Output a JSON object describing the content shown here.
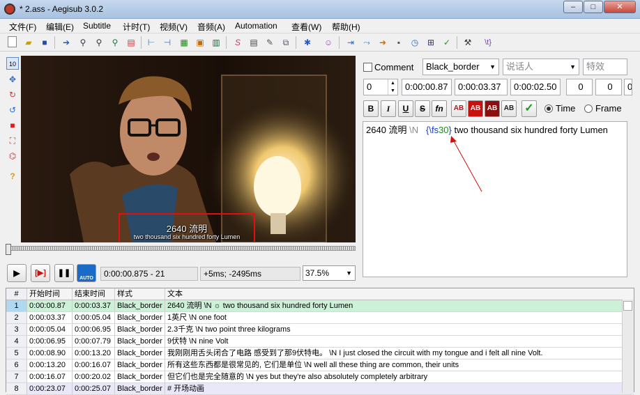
{
  "window": {
    "title": "* 2.ass - Aegisub 3.0.2",
    "minimize": "–",
    "maximize": "□",
    "close": "✕"
  },
  "menu": [
    "文件(F)",
    "编辑(E)",
    "Subtitle",
    "计时(T)",
    "视频(V)",
    "音频(A)",
    "Automation",
    "查看(W)",
    "帮助(H)"
  ],
  "toolbar": {
    "items": [
      "new-icon",
      "open-icon",
      "save-icon",
      "jump-icon",
      "zoom-icon",
      "search-icon",
      "replace-icon",
      "properties-icon",
      "fonts-icon",
      "snap-start-icon",
      "snap-end-icon",
      "keyframe-icon",
      "video-details-icon",
      "shift-times-icon",
      "style-manager-icon",
      "attachments-icon",
      "timing-post-icon",
      "translation-icon",
      "resample-icon",
      "automation-icon",
      "options-icon",
      "scale-icon",
      "tags-toggle-icon",
      "kanji-timer-icon",
      "spell-check-icon",
      "hide-tags-icon"
    ],
    "tags_label": "\\t}"
  },
  "video_tools": [
    "standard-tool",
    "drag-tool",
    "rotate-z-tool",
    "rotate-xy-tool",
    "scale-tool",
    "clip-tool",
    "vector-clip-tool",
    "help-tool"
  ],
  "video": {
    "subtitle_line1": "2640 流明",
    "subtitle_line2": "two thousand six hundred forty Lumen"
  },
  "playback": {
    "play": "▶",
    "play_line": "[▶]",
    "pause": "❚❚",
    "auto_label": "AUTO",
    "time_frame": "0:00:00.875 - 21",
    "offset": "+5ms; -2495ms",
    "zoom": "37.5%"
  },
  "edit": {
    "comment_label": "Comment",
    "style": "Black_border",
    "actor_placeholder": "说话人",
    "effect_placeholder": "特效",
    "layer": "0",
    "start": "0:00:00.87",
    "end": "0:00:03.37",
    "duration": "0:00:02.50",
    "margin_l": "0",
    "margin_r": "0",
    "margin_v": "0",
    "bold": "B",
    "italic": "I",
    "underline": "U",
    "strike": "S",
    "font": "fn",
    "color_labels": [
      "AB",
      "AB",
      "AB",
      "AB"
    ],
    "commit": "✓",
    "time_label": "Time",
    "frame_label": "Frame",
    "text_prefix": "2640 流明 ",
    "text_newline": "\\N",
    "text_tag_open": "{\\fs",
    "text_tag_val": "30",
    "text_tag_close": "}",
    "text_rest": " two thousand six hundred forty Lumen"
  },
  "grid": {
    "headers": [
      "#",
      "开始时间",
      "结束时间",
      "样式",
      "文本"
    ],
    "rows": [
      [
        "1",
        "0:00:00.87",
        "0:00:03.37",
        "Black_border",
        "2640 流明 \\N ☼ two thousand six hundred forty Lumen"
      ],
      [
        "2",
        "0:00:03.37",
        "0:00:05.04",
        "Black_border",
        "1英尺 \\N one foot"
      ],
      [
        "3",
        "0:00:05.04",
        "0:00:06.95",
        "Black_border",
        "2.3千克 \\N two point three kilograms"
      ],
      [
        "4",
        "0:00:06.95",
        "0:00:07.79",
        "Black_border",
        "9伏特 \\N nine Volt"
      ],
      [
        "5",
        "0:00:08.90",
        "0:00:13.20",
        "Black_border",
        "我刚刚用舌头闭合了电路 感受到了那9伏特电。 \\N I just closed the circuit with my tongue and i felt all nine Volt."
      ],
      [
        "6",
        "0:00:13.20",
        "0:00:16.07",
        "Black_border",
        "所有这些东西都是很常见的, 它们是单位 \\N well all these thing are common, their units"
      ],
      [
        "7",
        "0:00:16.07",
        "0:00:20.02",
        "Black_border",
        "但它们也是完全随意的 \\N yes but they're also absolutely completely arbitrary"
      ],
      [
        "8",
        "0:00:23.07",
        "0:00:25.07",
        "Black_border",
        "# 开场动画"
      ]
    ]
  }
}
